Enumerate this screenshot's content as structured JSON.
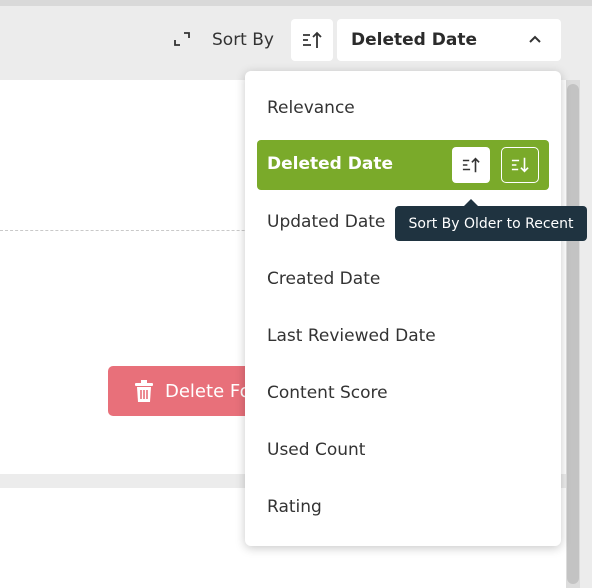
{
  "toolbar": {
    "expand_icon": "expand-icon",
    "sort_by_label": "Sort By",
    "sort_direction_icon": "sort-ascending-icon",
    "selected_sort": "Deleted Date",
    "dropdown_icon": "chevron-up-icon"
  },
  "background": {
    "delete_button_label": "Delete Fo",
    "delete_icon": "trash-icon"
  },
  "menu": {
    "items": [
      {
        "label": "Relevance"
      },
      {
        "label": "Deleted Date",
        "selected": true
      },
      {
        "label": "Updated Date"
      },
      {
        "label": "Created Date"
      },
      {
        "label": "Last Reviewed Date"
      },
      {
        "label": "Content Score"
      },
      {
        "label": "Used Count"
      },
      {
        "label": "Rating"
      }
    ],
    "asc_icon": "sort-ascending-icon",
    "desc_icon": "sort-descending-icon"
  },
  "tooltip": {
    "text": "Sort By Older to Recent"
  },
  "colors": {
    "selected_bg": "#7aaa2a",
    "tooltip_bg": "#1f3340",
    "delete_bg": "#e8707a"
  }
}
